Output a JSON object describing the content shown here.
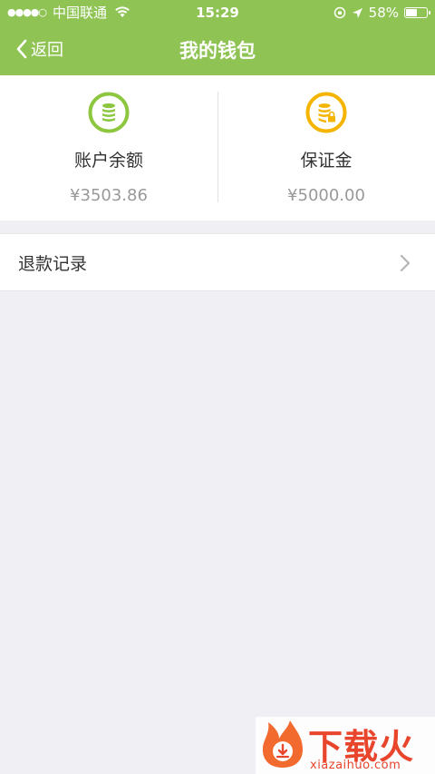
{
  "status_bar": {
    "signal": "●●●●○",
    "carrier": "中国联通",
    "time": "15:29",
    "battery": "58%",
    "battery_level": 0.58
  },
  "nav": {
    "back_label": "返回",
    "title": "我的钱包"
  },
  "wallet": {
    "balance_label": "账户余额",
    "balance_amount": "¥3503.86",
    "deposit_label": "保证金",
    "deposit_amount": "¥5000.00"
  },
  "menu": {
    "refund_label": "退款记录"
  },
  "watermark": {
    "title": "下载火",
    "url": "xiazaihuo.com"
  },
  "colors": {
    "header": "#8fc454",
    "balance_icon": "#8dc63f",
    "deposit_icon": "#f5b400",
    "watermark": "#e8452c"
  }
}
